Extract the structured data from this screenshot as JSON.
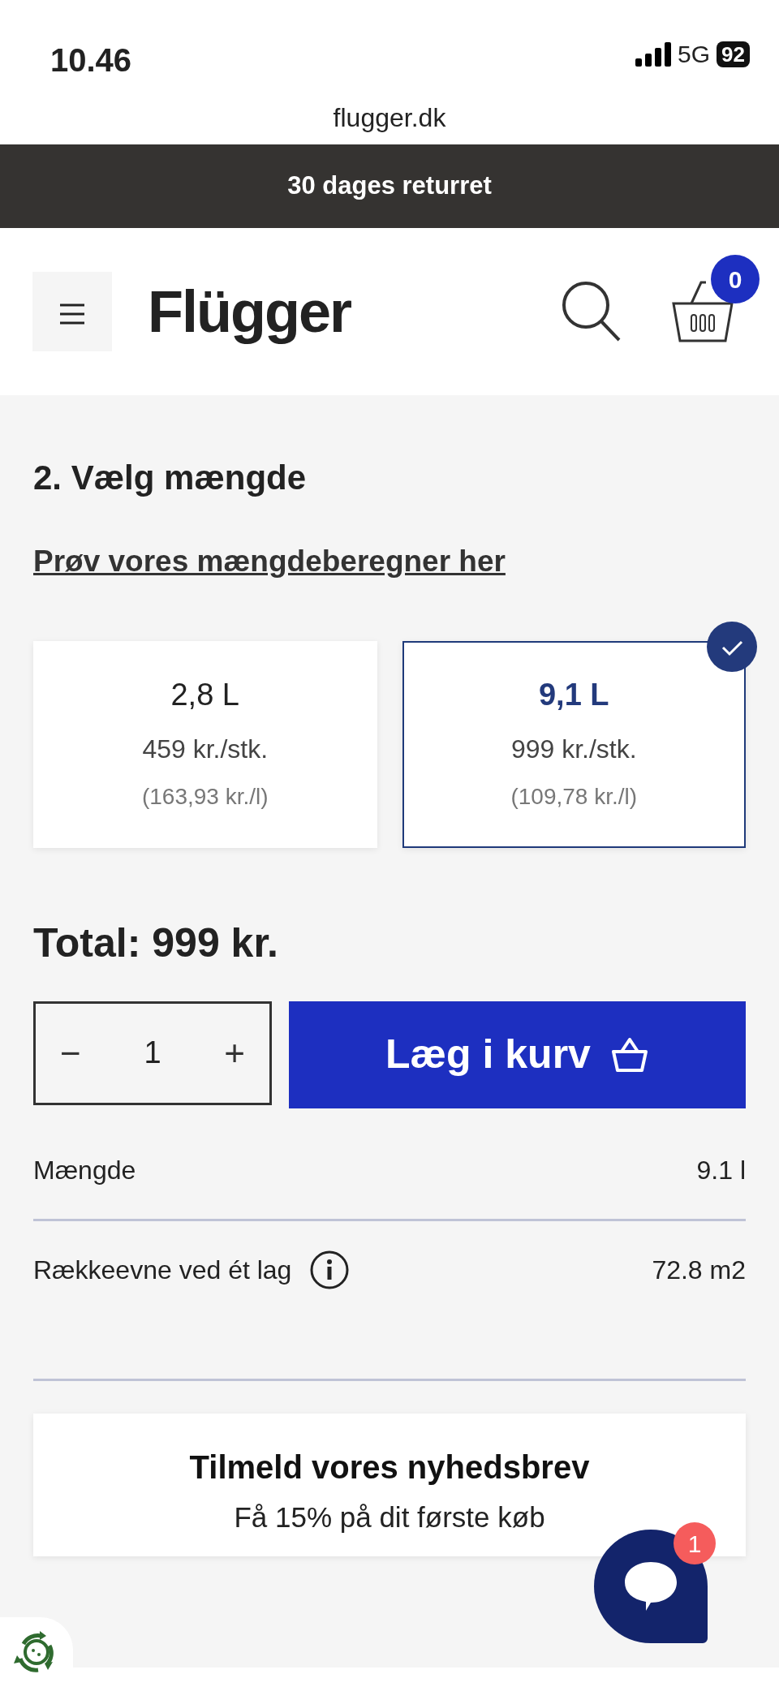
{
  "status_bar": {
    "time": "10.46",
    "network": "5G",
    "battery": "92"
  },
  "browser": {
    "url": "flugger.dk"
  },
  "promo_banner": "30 dages returret",
  "header": {
    "logo": "Flügger",
    "cart_count": "0"
  },
  "section": {
    "title": "2.  Vælg mængde",
    "calculator_link": "Prøv vores mængdeberegner her"
  },
  "options": [
    {
      "volume": "2,8 L",
      "price": "459 kr./stk.",
      "unit_price": "(163,93 kr./l)",
      "selected": false
    },
    {
      "volume": "9,1 L",
      "price": "999 kr./stk.",
      "unit_price": "(109,78 kr./l)",
      "selected": true
    }
  ],
  "total": "Total: 999 kr.",
  "quantity": {
    "minus": "−",
    "value": "1",
    "plus": "+"
  },
  "add_button": "Læg i kurv",
  "specs": [
    {
      "label": "Mængde",
      "value": "9.1 l",
      "info": false
    },
    {
      "label": "Rækkeevne ved ét lag",
      "value": "72.8 m2",
      "info": true
    }
  ],
  "newsletter": {
    "title": "Tilmeld vores nyhedsbrev",
    "subtitle": "Få 15% på dit første køb"
  },
  "chat": {
    "badge": "1"
  }
}
